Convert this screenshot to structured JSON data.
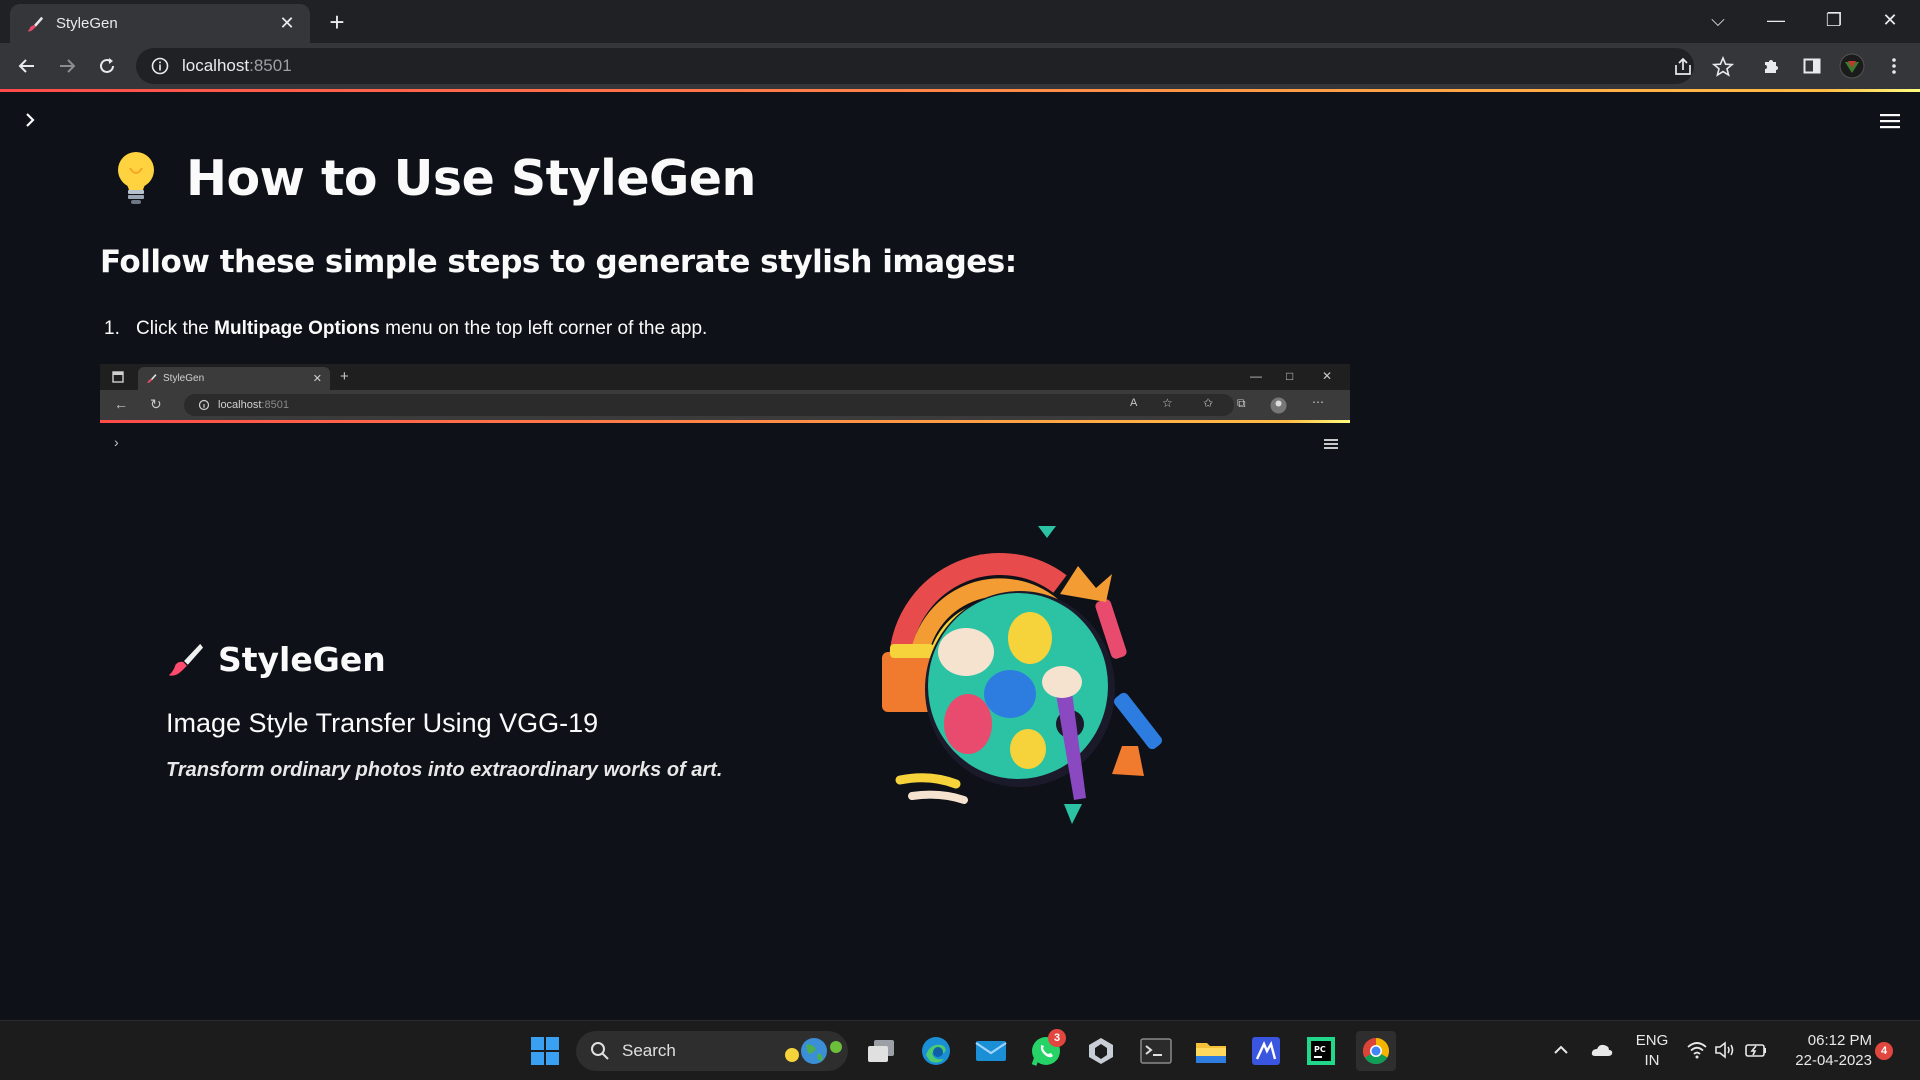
{
  "browser": {
    "tab_title": "StyleGen",
    "tab_close": "✕",
    "new_tab": "+",
    "url_host": "localhost",
    "url_port": ":8501",
    "window_controls": {
      "tabsearch": "⌵",
      "minimize": "—",
      "restore": "❐",
      "close": "✕"
    }
  },
  "page": {
    "title": "How to Use StyleGen",
    "title_emoji": "lightbulb-icon",
    "subtitle": "Follow these simple steps to generate stylish images:",
    "step": {
      "number": "1.",
      "prefix": "Click the ",
      "bold": "Multipage Options",
      "suffix": " menu on the top left corner of the app."
    }
  },
  "screenshot": {
    "tab_title": "StyleGen",
    "url_host": "localhost",
    "url_port": ":8501",
    "brand_title": "StyleGen",
    "tagline": "Image Style Transfer Using VGG-19",
    "subline": "Transform ordinary photos into extraordinary works of art."
  },
  "taskbar": {
    "search_label": "Search",
    "whatsapp_badge": "3",
    "lang_line1": "ENG",
    "lang_line2": "IN",
    "time": "06:12 PM",
    "date": "22-04-2023",
    "notification_badge": "4"
  },
  "colors": {
    "app_bg": "#0e1117",
    "accent_red": "#ff4b4b",
    "accent_yellow": "#ffbd45"
  }
}
